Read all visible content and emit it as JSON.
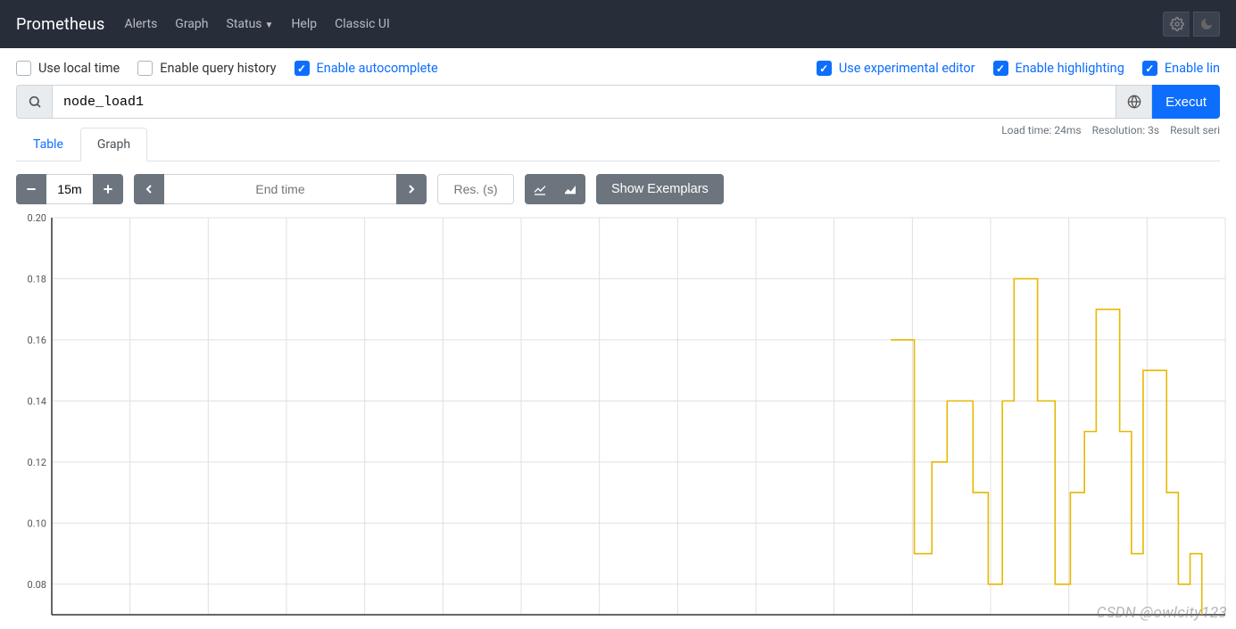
{
  "brand": "Prometheus",
  "nav": {
    "alerts": "Alerts",
    "graph": "Graph",
    "status": "Status",
    "help": "Help",
    "classic": "Classic UI"
  },
  "options": {
    "use_local_time": "Use local time",
    "enable_query_history": "Enable query history",
    "enable_autocomplete": "Enable autocomplete",
    "use_experimental_editor": "Use experimental editor",
    "enable_highlighting": "Enable highlighting",
    "enable_linter": "Enable lin"
  },
  "query": {
    "expression": "node_load1",
    "execute_label": "Execut"
  },
  "meta": {
    "load_time": "Load time: 24ms",
    "resolution": "Resolution: 3s",
    "result_series": "Result seri"
  },
  "tabs": {
    "table": "Table",
    "graph": "Graph"
  },
  "controls": {
    "range": "15m",
    "end_time_placeholder": "End time",
    "res_placeholder": "Res. (s)",
    "show_exemplars": "Show Exemplars"
  },
  "watermark": "CSDN @owlcity123",
  "chart_data": {
    "type": "line",
    "title": "",
    "xlabel": "",
    "ylabel": "",
    "ylim": [
      0.07,
      0.2
    ],
    "yticks": [
      0.08,
      0.1,
      0.12,
      0.14,
      0.16,
      0.18,
      0.2
    ],
    "x_range": [
      0,
      100
    ],
    "series": [
      {
        "name": "node_load1",
        "color": "#e6b800",
        "points": [
          [
            71.5,
            0.16
          ],
          [
            73.5,
            0.16
          ],
          [
            73.5,
            0.09
          ],
          [
            75.0,
            0.09
          ],
          [
            75.0,
            0.12
          ],
          [
            76.3,
            0.12
          ],
          [
            76.3,
            0.14
          ],
          [
            78.5,
            0.14
          ],
          [
            78.5,
            0.11
          ],
          [
            79.8,
            0.11
          ],
          [
            79.8,
            0.08
          ],
          [
            81.0,
            0.08
          ],
          [
            81.0,
            0.14
          ],
          [
            82.0,
            0.14
          ],
          [
            82.0,
            0.18
          ],
          [
            84.0,
            0.18
          ],
          [
            84.0,
            0.14
          ],
          [
            85.5,
            0.14
          ],
          [
            85.5,
            0.08
          ],
          [
            86.8,
            0.08
          ],
          [
            86.8,
            0.11
          ],
          [
            88.0,
            0.11
          ],
          [
            88.0,
            0.13
          ],
          [
            89.0,
            0.13
          ],
          [
            89.0,
            0.17
          ],
          [
            91.0,
            0.17
          ],
          [
            91.0,
            0.13
          ],
          [
            92.0,
            0.13
          ],
          [
            92.0,
            0.09
          ],
          [
            93.0,
            0.09
          ],
          [
            93.0,
            0.15
          ],
          [
            95.0,
            0.15
          ],
          [
            95.0,
            0.11
          ],
          [
            96.0,
            0.11
          ],
          [
            96.0,
            0.08
          ],
          [
            97.0,
            0.08
          ],
          [
            97.0,
            0.09
          ],
          [
            98.0,
            0.09
          ],
          [
            98.0,
            0.07
          ]
        ]
      }
    ]
  }
}
